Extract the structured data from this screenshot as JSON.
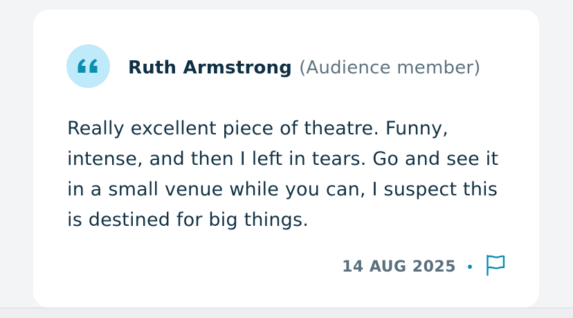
{
  "review": {
    "quote_icon": "quote-icon",
    "reviewer_name": "Ruth Armstrong",
    "reviewer_role": "(Audience member)",
    "body": "Really excellent piece of theatre. Funny, intense, and then I left in tears. Go and see it in a small venue while you can, I suspect this is destined for big things.",
    "date": "14 AUG 2025",
    "report_icon": "flag-icon"
  },
  "colors": {
    "accent": "#0b8fb0",
    "badge_background": "#bfeaf9",
    "name_text": "#0f2f44",
    "secondary_text": "#5f7380",
    "body_text": "#123245",
    "card_background": "#ffffff",
    "page_background": "#f3f4f6"
  }
}
